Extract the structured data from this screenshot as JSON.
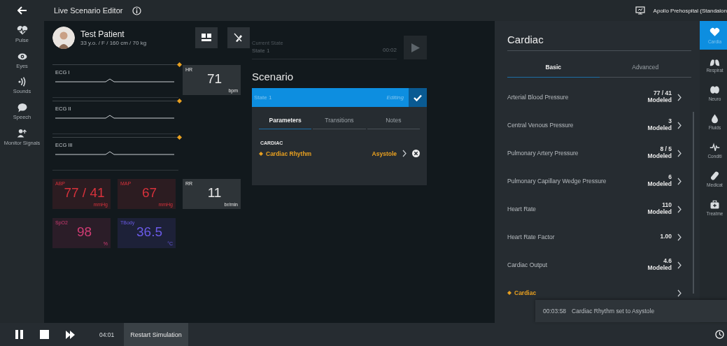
{
  "header": {
    "title": "Live Scenario Editor",
    "device": "Apollo Prehospital (Standalon"
  },
  "left_nav": [
    {
      "label": "Pulse"
    },
    {
      "label": "Eyes"
    },
    {
      "label": "Sounds"
    },
    {
      "label": "Speech"
    },
    {
      "label": "Monitor Signals"
    }
  ],
  "patient": {
    "name": "Test Patient",
    "details": "33 y.o. / F / 160 cm / 70 kg"
  },
  "ecg": [
    {
      "label": "ECG I"
    },
    {
      "label": "ECG II"
    },
    {
      "label": "ECG III"
    }
  ],
  "vitals": [
    {
      "label": "HR",
      "value": "71",
      "unit": "bpm",
      "color": "#e6e6e6"
    },
    {
      "label": "ABP",
      "value": "77 / 41",
      "unit": "mmHg",
      "color": "#d8323c"
    },
    {
      "label": "MAP",
      "value": "67",
      "unit": "mmHg",
      "color": "#d8323c"
    },
    {
      "label": "RR",
      "value": "11",
      "unit": "br/min",
      "color": "#e6e6e6"
    },
    {
      "label": "SpO2",
      "value": "98",
      "unit": "%",
      "color": "#d03c74"
    },
    {
      "label": "TBody",
      "value": "36.5",
      "unit": "°C",
      "color": "#6a5ae6"
    }
  ],
  "current_state": {
    "label": "Current State",
    "value": "State 1",
    "time": "00:02"
  },
  "scenario": {
    "title": "Scenario",
    "state": {
      "name": "State 1",
      "status": "Editing"
    },
    "tabs": [
      {
        "label": "Parameters",
        "selected": true
      },
      {
        "label": "Transitions",
        "selected": false
      },
      {
        "label": "Notes",
        "selected": false
      }
    ],
    "section": "CARDIAC",
    "parameters": [
      {
        "name": "Cardiac Rhythm",
        "value": "Asystole",
        "modified": true
      }
    ]
  },
  "cardiac_panel": {
    "title": "Cardiac",
    "tabs": [
      {
        "label": "Basic",
        "selected": true
      },
      {
        "label": "Advanced",
        "selected": false
      }
    ],
    "rows": [
      {
        "label": "Arterial Blood Pressure",
        "value": "77 / 41",
        "source": "Modeled",
        "modified": false
      },
      {
        "label": "Central Venous Pressure",
        "value": "3",
        "source": "Modeled",
        "modified": false
      },
      {
        "label": "Pulmonary Artery Pressure",
        "value": "8 / 5",
        "source": "Modeled",
        "modified": false
      },
      {
        "label": "Pulmonary Capillary Wedge Pressure",
        "value": "6",
        "source": "Modeled",
        "modified": false
      },
      {
        "label": "Heart Rate",
        "value": "110",
        "source": "Modeled",
        "modified": false
      },
      {
        "label": "Heart Rate Factor",
        "value": "1.00",
        "modified": false
      },
      {
        "label": "Cardiac Output",
        "value": "4.6",
        "source": "Modeled",
        "modified": false
      },
      {
        "label": "Cardiac",
        "modified": true
      }
    ]
  },
  "categories": [
    {
      "label": "Cardia",
      "selected": true
    },
    {
      "label": "Respirat",
      "selected": false
    },
    {
      "label": "Neuro",
      "selected": false
    },
    {
      "label": "Fluids",
      "selected": false
    },
    {
      "label": "Conditi",
      "selected": false
    },
    {
      "label": "Medicat",
      "selected": false
    },
    {
      "label": "Treatme",
      "selected": false
    }
  ],
  "controls": {
    "time": "04:01",
    "restart": "Restart Simulation"
  },
  "toast": {
    "time": "00:03:58",
    "message": "Cardiac Rhythm set to Asystole"
  }
}
